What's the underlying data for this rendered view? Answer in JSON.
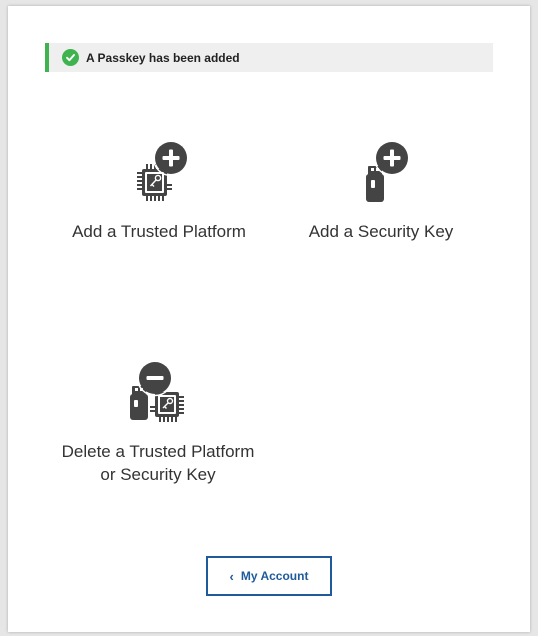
{
  "alert": {
    "message": "A Passkey has been added",
    "icon": "check-circle-icon",
    "accent_color": "#3fb34f"
  },
  "options": [
    {
      "label": "Add a Trusted Platform",
      "icon": "add-trusted-platform-icon"
    },
    {
      "label": "Add a Security Key",
      "icon": "add-security-key-icon"
    },
    {
      "label": "Delete a Trusted Platform\nor Security Key",
      "icon": "delete-credential-icon"
    }
  ],
  "back_button": {
    "label": "My Account",
    "chevron": "‹",
    "color": "#1f5a9a"
  }
}
